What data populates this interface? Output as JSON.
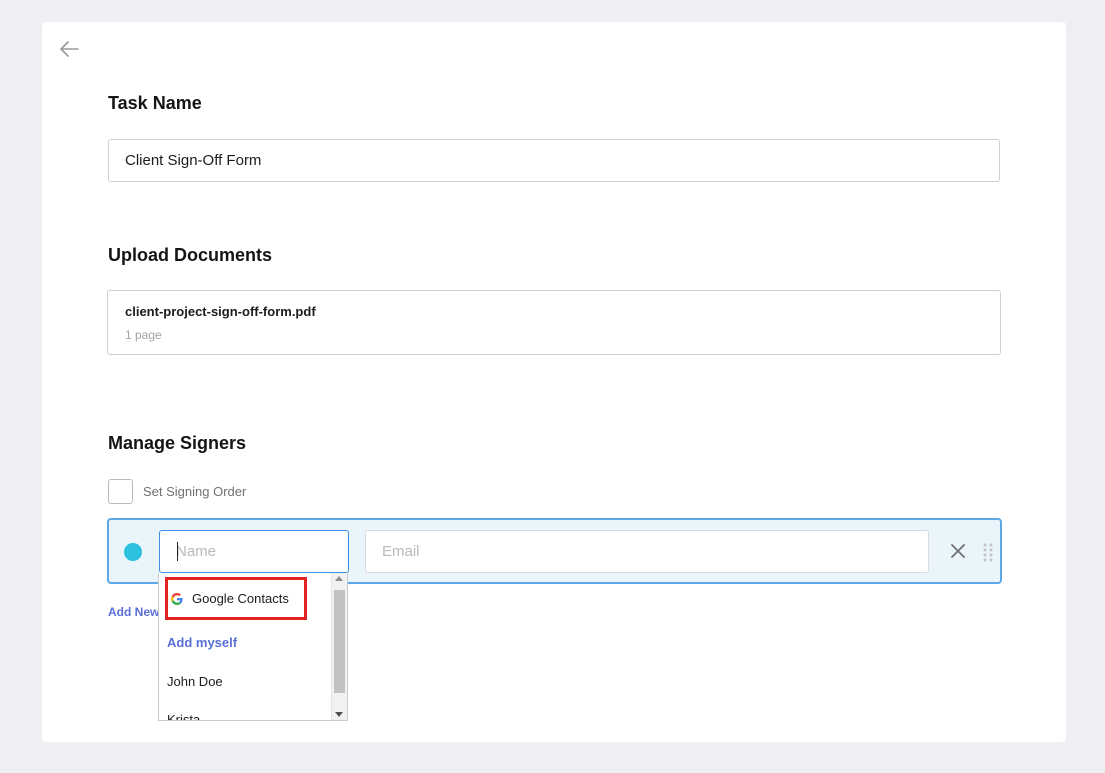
{
  "task_name": {
    "heading": "Task Name",
    "value": "Client Sign-Off Form"
  },
  "upload_documents": {
    "heading": "Upload Documents",
    "file_name": "client-project-sign-off-form.pdf",
    "page_count": "1 page"
  },
  "manage_signers": {
    "heading": "Manage Signers",
    "signing_order_label": "Set Signing Order",
    "name_placeholder": "Name",
    "email_placeholder": "Email",
    "add_new_label": "Add New",
    "signer_dot_color": "#2ec0df"
  },
  "dropdown": {
    "google_contacts": "Google Contacts",
    "add_myself": "Add myself",
    "contacts": [
      "John Doe",
      "Krista"
    ]
  },
  "icons": {
    "back": "arrow-left-icon",
    "remove": "close-icon",
    "drag": "drag-handle-icon",
    "google": "google-g-icon"
  },
  "colors": {
    "accent_link": "#5a6fd6",
    "focus_border": "#3e8ee6",
    "highlight_box": "#e02424"
  }
}
